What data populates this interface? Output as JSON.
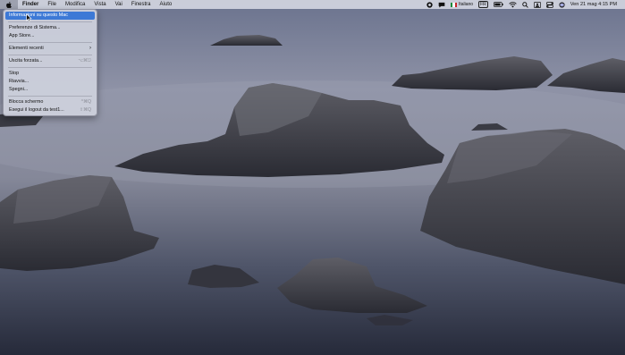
{
  "menubar": {
    "apple_icon": "apple-logo-icon",
    "items": [
      "Finder",
      "File",
      "Modifica",
      "Vista",
      "Vai",
      "Finestra",
      "Aiuto"
    ],
    "status": {
      "keyboard_layout": "Italiano",
      "input_badge": "FR",
      "datetime": "Ven 21 mag  4:15 PM"
    }
  },
  "apple_menu": {
    "items": [
      {
        "label": "Informazioni su questo Mac",
        "shortcut": "",
        "selected": true
      },
      {
        "label": "Preferenze di Sistema...",
        "shortcut": ""
      },
      {
        "label": "App Store...",
        "shortcut": ""
      },
      {
        "label": "Elementi recenti",
        "shortcut": "",
        "submenu": true
      },
      {
        "label": "Uscita forzata...",
        "shortcut": "⌥⌘⎋"
      },
      {
        "label": "Stop",
        "shortcut": ""
      },
      {
        "label": "Riavvia...",
        "shortcut": ""
      },
      {
        "label": "Spegni...",
        "shortcut": ""
      },
      {
        "label": "Blocca schermo",
        "shortcut": "^⌘Q"
      },
      {
        "label": "Esegui il logout da test1...",
        "shortcut": "⇧⌘Q"
      }
    ],
    "submenu_chevron": "›"
  },
  "colors": {
    "menu_highlight": "#3d79d6",
    "menubar_bg": "#d7dae4"
  }
}
